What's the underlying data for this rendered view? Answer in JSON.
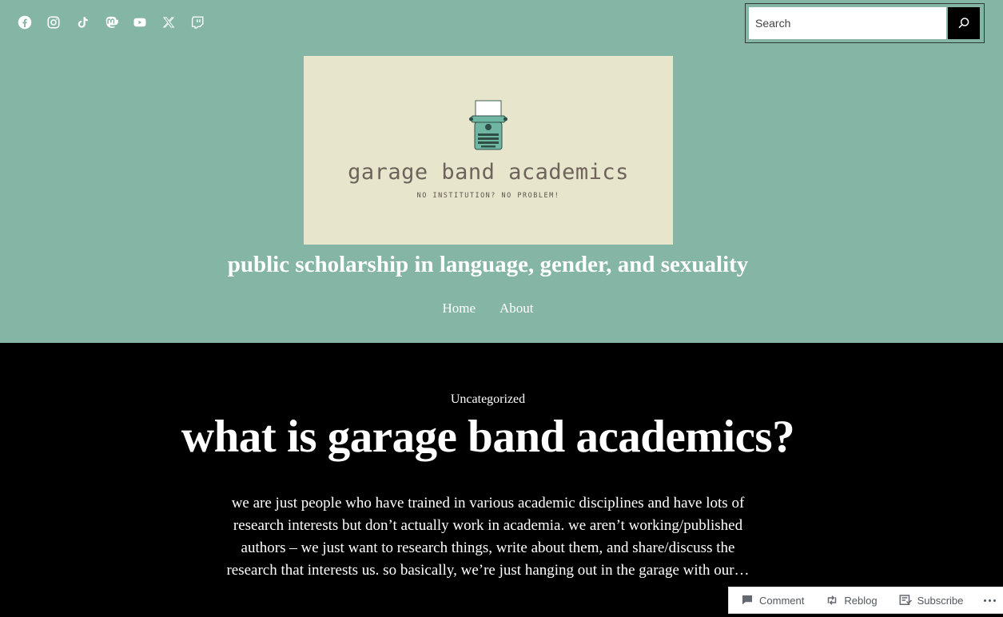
{
  "social": {
    "icons": [
      "facebook-icon",
      "instagram-icon",
      "tiktok-icon",
      "mastodon-icon",
      "youtube-icon",
      "x-icon",
      "twitch-icon"
    ]
  },
  "search": {
    "placeholder": "Search"
  },
  "logo": {
    "title": "garage band academics",
    "subtitle": "NO INSTITUTION? NO PROBLEM!"
  },
  "site": {
    "tagline": "public scholarship in language, gender, and sexuality"
  },
  "nav": {
    "items": [
      {
        "label": "Home"
      },
      {
        "label": "About"
      }
    ]
  },
  "post": {
    "category": "Uncategorized",
    "title": "what is garage band academics?",
    "excerpt": "we are just people who have trained in various academic disciplines and have lots of research interests but don’t actually work in academia. we aren’t working/published authors – we just want to research things, write about them, and share/discuss the research that interests us. so basically, we’re just hanging out in the garage with our…"
  },
  "actionbar": {
    "comment": "Comment",
    "reblog": "Reblog",
    "subscribe": "Subscribe"
  },
  "colors": {
    "header_bg": "#85b6a5",
    "logo_bg": "#e7e5cc",
    "body_bg": "#000000"
  }
}
